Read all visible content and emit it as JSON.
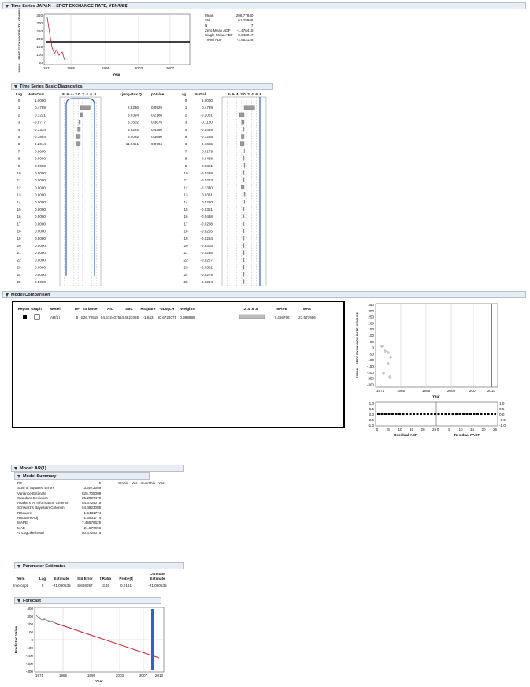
{
  "ts_header": "Time Series JAPAN -- SPOT EXCHANGE RATE, YEN/US$",
  "ts_plot": {
    "ylabel": "JAPAN -- SPOT EXCHANGE RATE, YEN/US$",
    "xlabel": "Year",
    "yticks": [
      "350",
      "300",
      "250",
      "200",
      "150",
      "100",
      "50"
    ],
    "xticks": [
      "1971",
      "1985",
      "1995",
      "2003",
      "2007"
    ]
  },
  "ts_stats": [
    [
      "Mean",
      "206.77840"
    ],
    [
      "Std",
      "61.25868"
    ],
    [
      "N",
      "7"
    ],
    [
      "Zero Mean ADF",
      "-1.476415"
    ],
    [
      "Single Mean ADF",
      "-0.648017"
    ],
    [
      "Trend ADF",
      "-2.962128"
    ]
  ],
  "diag_header": "Time Series Basic Diagnostics",
  "diag_cols": {
    "lag": "Lag",
    "ac": "AutoCorr",
    "scale": ".8-.6-.4-.2 0 .2 .4 .6 .8",
    "q": "Ljung-Box Q",
    "p": "p-Value",
    "lag2": "Lag",
    "pac": "Partial",
    "scale2": ".8-.6-.4-.2 0 .2 .4 .6 .8"
  },
  "diag_rows": [
    [
      "0",
      "1.0000",
      "",
      "",
      "0",
      "1.0000"
    ],
    [
      "1",
      "0.4789",
      "2.8236",
      "0.0929",
      "1",
      "0.4789"
    ],
    [
      "2",
      "0.1221",
      "3.0394",
      "0.2188",
      "2",
      "-0.2081"
    ],
    [
      "3",
      "-0.0777",
      "3.1602",
      "0.3676",
      "3",
      "-0.1180"
    ],
    [
      "4",
      "-0.1334",
      "3.6225",
      "0.4596",
      "4",
      "-0.0429"
    ],
    [
      "5",
      "-0.1854",
      "5.4025",
      "0.3690",
      "5",
      "-0.1268"
    ],
    [
      "6",
      "-0.2044",
      "11.6451",
      "0.0704",
      "6",
      "-0.1665"
    ],
    [
      "7",
      "0.0000",
      "",
      "",
      "7",
      "0.0179"
    ],
    [
      "8",
      "0.0000",
      "",
      "",
      "8",
      "-0.0488"
    ],
    [
      "9",
      "0.0000",
      "",
      "",
      "9",
      "0.0351"
    ],
    [
      "10",
      "0.0000",
      "",
      "",
      "10",
      "-0.0229"
    ],
    [
      "11",
      "0.0000",
      "",
      "",
      "11",
      "-0.0283"
    ],
    [
      "12",
      "0.0000",
      "",
      "",
      "12",
      "-0.1330"
    ],
    [
      "13",
      "0.0000",
      "",
      "",
      "13",
      "0.0381"
    ],
    [
      "14",
      "0.0000",
      "",
      "",
      "14",
      "0.0260"
    ],
    [
      "15",
      "0.0000",
      "",
      "",
      "15",
      "-0.0351"
    ],
    [
      "16",
      "0.0000",
      "",
      "",
      "16",
      "-0.0488"
    ],
    [
      "17",
      "0.0000",
      "",
      "",
      "17",
      "-0.0208"
    ],
    [
      "18",
      "0.0000",
      "",
      "",
      "18",
      "-0.0255"
    ],
    [
      "19",
      "0.0000",
      "",
      "",
      "19",
      "-0.0254"
    ],
    [
      "20",
      "0.0000",
      "",
      "",
      "20",
      "-0.0303"
    ],
    [
      "21",
      "0.0000",
      "",
      "",
      "21",
      "-0.0236"
    ],
    [
      "22",
      "0.0000",
      "",
      "",
      "22",
      "-0.0227"
    ],
    [
      "23",
      "0.0000",
      "",
      "",
      "23",
      "-0.0302"
    ],
    [
      "24",
      "0.0000",
      "",
      "",
      "24",
      "-0.0279"
    ],
    [
      "25",
      "0.0000",
      "",
      "",
      "25",
      "-0.0284"
    ]
  ],
  "mc_header": "Model Comparison",
  "mc_cols": [
    "Report",
    "Graph",
    "Model",
    "DF",
    "Variance",
    "AIC",
    "SBC",
    "RSquare",
    "-2LogLH",
    "Weights",
    ".2 .4 .6 .8",
    "MAPE",
    "MAE"
  ],
  "mc_row": [
    "",
    "",
    "AR(1)",
    "5",
    "826.70518",
    "54.6724075",
    "54.4823085",
    "-1.643",
    "50.6724075",
    "0.999998",
    "",
    "7.456796",
    "21.577996"
  ],
  "mc_plot": {
    "ylabel": "JAPAN -- SPOT EXCHANGE RATE, YEN/US$",
    "xlabel": "Year",
    "yticks": [
      "350",
      "300",
      "250",
      "200",
      "150",
      "100",
      "50",
      "0",
      "-50",
      "-100",
      "-150",
      "-200",
      "-250",
      "-300"
    ],
    "xticks": [
      "1971",
      "1985",
      "1995",
      "2003",
      "2007",
      "2010"
    ]
  },
  "mc_resid": {
    "yticks_l": [
      "1.0",
      "0.5",
      "0.0",
      "-0.5",
      "-1.0"
    ],
    "yticks_r": [
      "1.0",
      "0.5",
      "0.0",
      "-0.5",
      "-1.0"
    ],
    "xticks": [
      "0",
      "5",
      "10",
      "15",
      "20",
      "25",
      "0",
      "5",
      "10",
      "15",
      "20",
      "25"
    ],
    "xlabel_l": "Residual ACF",
    "xlabel_r": "Residual PACF"
  },
  "model_header": "Model: AR(1)",
  "summary_header": "Model Summary",
  "summary_rows": [
    [
      "DF",
      "5"
    ],
    [
      "Sum of Squared Errors",
      "3349.2059"
    ],
    [
      "Variance Estimate",
      "826.705009"
    ],
    [
      "Standard Deviation",
      "25.2007470"
    ],
    [
      "Akaike's 'A' Information Criterion",
      "54.6724075"
    ],
    [
      "Schwarz's Bayesian Criterion",
      "54.4823085"
    ],
    [
      "RSquare",
      "-1.6431774"
    ],
    [
      "RSquare Adj",
      "-1.6431774"
    ],
    [
      "MAPE",
      "7.45679625"
    ],
    [
      "MAE",
      "21.577996"
    ],
    [
      "-2 LogLikelihood",
      "50.6724075"
    ]
  ],
  "summary_side": [
    [
      "Stable",
      "Yes"
    ],
    [
      "Invertible",
      "Yes"
    ]
  ],
  "param_header": "Parameter Estimates",
  "param_cols": [
    "Term",
    "Lag",
    "Estimate",
    "Std Error",
    "t Ratio",
    "Prob>|t|",
    "Constant Estimate"
  ],
  "param_row": [
    "Intercept",
    "0",
    "-21.090535",
    "6.608057",
    "-3.40",
    "0.0191",
    "-21.090535"
  ],
  "forecast_header": "Forecast",
  "forecast_plot": {
    "ylabel": "Predicted Value",
    "xlabel": "Year",
    "yticks": [
      "400",
      "300",
      "200",
      "100",
      "0",
      "-100",
      "-200",
      "-300",
      "-400"
    ],
    "xticks": [
      "1971",
      "1985",
      "1995",
      "2003",
      "2007",
      "2010"
    ]
  },
  "colors": {
    "series": "#cc1e2c",
    "acf_band": "#2f63c9",
    "marker_blue": "#2f63c9",
    "bar": "#999999"
  }
}
